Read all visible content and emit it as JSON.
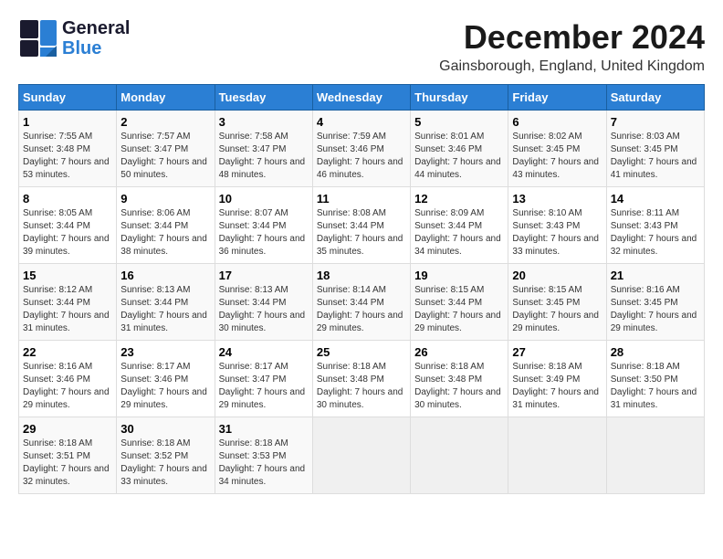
{
  "header": {
    "logo_line1": "General",
    "logo_line2": "Blue",
    "title": "December 2024",
    "subtitle": "Gainsborough, England, United Kingdom"
  },
  "weekdays": [
    "Sunday",
    "Monday",
    "Tuesday",
    "Wednesday",
    "Thursday",
    "Friday",
    "Saturday"
  ],
  "weeks": [
    [
      {
        "day": "1",
        "sunrise": "Sunrise: 7:55 AM",
        "sunset": "Sunset: 3:48 PM",
        "daylight": "Daylight: 7 hours and 53 minutes."
      },
      {
        "day": "2",
        "sunrise": "Sunrise: 7:57 AM",
        "sunset": "Sunset: 3:47 PM",
        "daylight": "Daylight: 7 hours and 50 minutes."
      },
      {
        "day": "3",
        "sunrise": "Sunrise: 7:58 AM",
        "sunset": "Sunset: 3:47 PM",
        "daylight": "Daylight: 7 hours and 48 minutes."
      },
      {
        "day": "4",
        "sunrise": "Sunrise: 7:59 AM",
        "sunset": "Sunset: 3:46 PM",
        "daylight": "Daylight: 7 hours and 46 minutes."
      },
      {
        "day": "5",
        "sunrise": "Sunrise: 8:01 AM",
        "sunset": "Sunset: 3:46 PM",
        "daylight": "Daylight: 7 hours and 44 minutes."
      },
      {
        "day": "6",
        "sunrise": "Sunrise: 8:02 AM",
        "sunset": "Sunset: 3:45 PM",
        "daylight": "Daylight: 7 hours and 43 minutes."
      },
      {
        "day": "7",
        "sunrise": "Sunrise: 8:03 AM",
        "sunset": "Sunset: 3:45 PM",
        "daylight": "Daylight: 7 hours and 41 minutes."
      }
    ],
    [
      {
        "day": "8",
        "sunrise": "Sunrise: 8:05 AM",
        "sunset": "Sunset: 3:44 PM",
        "daylight": "Daylight: 7 hours and 39 minutes."
      },
      {
        "day": "9",
        "sunrise": "Sunrise: 8:06 AM",
        "sunset": "Sunset: 3:44 PM",
        "daylight": "Daylight: 7 hours and 38 minutes."
      },
      {
        "day": "10",
        "sunrise": "Sunrise: 8:07 AM",
        "sunset": "Sunset: 3:44 PM",
        "daylight": "Daylight: 7 hours and 36 minutes."
      },
      {
        "day": "11",
        "sunrise": "Sunrise: 8:08 AM",
        "sunset": "Sunset: 3:44 PM",
        "daylight": "Daylight: 7 hours and 35 minutes."
      },
      {
        "day": "12",
        "sunrise": "Sunrise: 8:09 AM",
        "sunset": "Sunset: 3:44 PM",
        "daylight": "Daylight: 7 hours and 34 minutes."
      },
      {
        "day": "13",
        "sunrise": "Sunrise: 8:10 AM",
        "sunset": "Sunset: 3:43 PM",
        "daylight": "Daylight: 7 hours and 33 minutes."
      },
      {
        "day": "14",
        "sunrise": "Sunrise: 8:11 AM",
        "sunset": "Sunset: 3:43 PM",
        "daylight": "Daylight: 7 hours and 32 minutes."
      }
    ],
    [
      {
        "day": "15",
        "sunrise": "Sunrise: 8:12 AM",
        "sunset": "Sunset: 3:44 PM",
        "daylight": "Daylight: 7 hours and 31 minutes."
      },
      {
        "day": "16",
        "sunrise": "Sunrise: 8:13 AM",
        "sunset": "Sunset: 3:44 PM",
        "daylight": "Daylight: 7 hours and 31 minutes."
      },
      {
        "day": "17",
        "sunrise": "Sunrise: 8:13 AM",
        "sunset": "Sunset: 3:44 PM",
        "daylight": "Daylight: 7 hours and 30 minutes."
      },
      {
        "day": "18",
        "sunrise": "Sunrise: 8:14 AM",
        "sunset": "Sunset: 3:44 PM",
        "daylight": "Daylight: 7 hours and 29 minutes."
      },
      {
        "day": "19",
        "sunrise": "Sunrise: 8:15 AM",
        "sunset": "Sunset: 3:44 PM",
        "daylight": "Daylight: 7 hours and 29 minutes."
      },
      {
        "day": "20",
        "sunrise": "Sunrise: 8:15 AM",
        "sunset": "Sunset: 3:45 PM",
        "daylight": "Daylight: 7 hours and 29 minutes."
      },
      {
        "day": "21",
        "sunrise": "Sunrise: 8:16 AM",
        "sunset": "Sunset: 3:45 PM",
        "daylight": "Daylight: 7 hours and 29 minutes."
      }
    ],
    [
      {
        "day": "22",
        "sunrise": "Sunrise: 8:16 AM",
        "sunset": "Sunset: 3:46 PM",
        "daylight": "Daylight: 7 hours and 29 minutes."
      },
      {
        "day": "23",
        "sunrise": "Sunrise: 8:17 AM",
        "sunset": "Sunset: 3:46 PM",
        "daylight": "Daylight: 7 hours and 29 minutes."
      },
      {
        "day": "24",
        "sunrise": "Sunrise: 8:17 AM",
        "sunset": "Sunset: 3:47 PM",
        "daylight": "Daylight: 7 hours and 29 minutes."
      },
      {
        "day": "25",
        "sunrise": "Sunrise: 8:18 AM",
        "sunset": "Sunset: 3:48 PM",
        "daylight": "Daylight: 7 hours and 30 minutes."
      },
      {
        "day": "26",
        "sunrise": "Sunrise: 8:18 AM",
        "sunset": "Sunset: 3:48 PM",
        "daylight": "Daylight: 7 hours and 30 minutes."
      },
      {
        "day": "27",
        "sunrise": "Sunrise: 8:18 AM",
        "sunset": "Sunset: 3:49 PM",
        "daylight": "Daylight: 7 hours and 31 minutes."
      },
      {
        "day": "28",
        "sunrise": "Sunrise: 8:18 AM",
        "sunset": "Sunset: 3:50 PM",
        "daylight": "Daylight: 7 hours and 31 minutes."
      }
    ],
    [
      {
        "day": "29",
        "sunrise": "Sunrise: 8:18 AM",
        "sunset": "Sunset: 3:51 PM",
        "daylight": "Daylight: 7 hours and 32 minutes."
      },
      {
        "day": "30",
        "sunrise": "Sunrise: 8:18 AM",
        "sunset": "Sunset: 3:52 PM",
        "daylight": "Daylight: 7 hours and 33 minutes."
      },
      {
        "day": "31",
        "sunrise": "Sunrise: 8:18 AM",
        "sunset": "Sunset: 3:53 PM",
        "daylight": "Daylight: 7 hours and 34 minutes."
      },
      null,
      null,
      null,
      null
    ]
  ]
}
